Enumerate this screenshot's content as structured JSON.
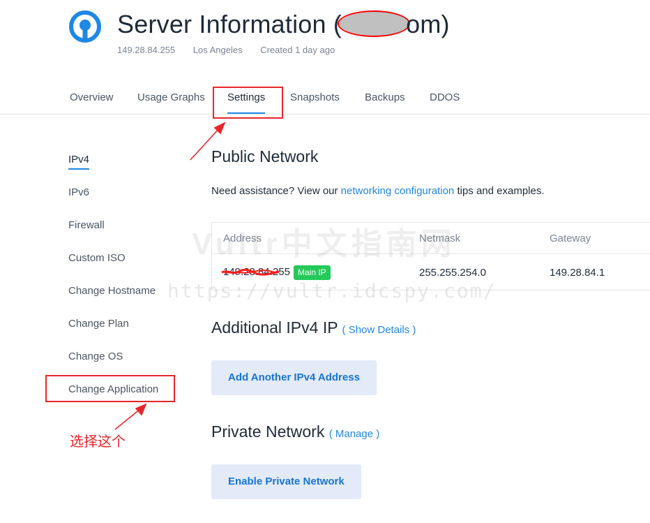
{
  "header": {
    "title_prefix": "Server Information (",
    "title_suffix": "om)",
    "ip": "149.28.84.255",
    "location": "Los Angeles",
    "created": "Created 1 day ago"
  },
  "tabs": [
    {
      "label": "Overview"
    },
    {
      "label": "Usage Graphs"
    },
    {
      "label": "Settings",
      "active": true
    },
    {
      "label": "Snapshots"
    },
    {
      "label": "Backups"
    },
    {
      "label": "DDOS"
    }
  ],
  "sidebar": {
    "items": [
      {
        "label": "IPv4",
        "active": true
      },
      {
        "label": "IPv6"
      },
      {
        "label": "Firewall"
      },
      {
        "label": "Custom ISO"
      },
      {
        "label": "Change Hostname"
      },
      {
        "label": "Change Plan"
      },
      {
        "label": "Change OS"
      },
      {
        "label": "Change Application"
      }
    ]
  },
  "public_network": {
    "title": "Public Network",
    "assist_prefix": "Need assistance? View our ",
    "assist_link": "networking configuration",
    "assist_suffix": " tips and examples.",
    "columns": [
      "Address",
      "Netmask",
      "Gateway"
    ],
    "row": {
      "address": "149.28.84.255",
      "badge": "Main IP",
      "netmask": "255.255.254.0",
      "gateway": "149.28.84.1"
    }
  },
  "additional_ipv4": {
    "title": "Additional IPv4 IP",
    "link": "( Show Details )",
    "button": "Add Another IPv4 Address"
  },
  "private_network": {
    "title": "Private Network",
    "link": "( Manage )",
    "button": "Enable Private Network"
  },
  "watermark": {
    "line1": "Vultr中文指南网",
    "line2": "https://vultr.idcspy.com/"
  },
  "annotation": {
    "text": "选择这个"
  },
  "colors": {
    "accent": "#1e88e5",
    "badge": "#24c95a",
    "annotation": "#e8262a",
    "button_bg": "#e3ebf8"
  }
}
